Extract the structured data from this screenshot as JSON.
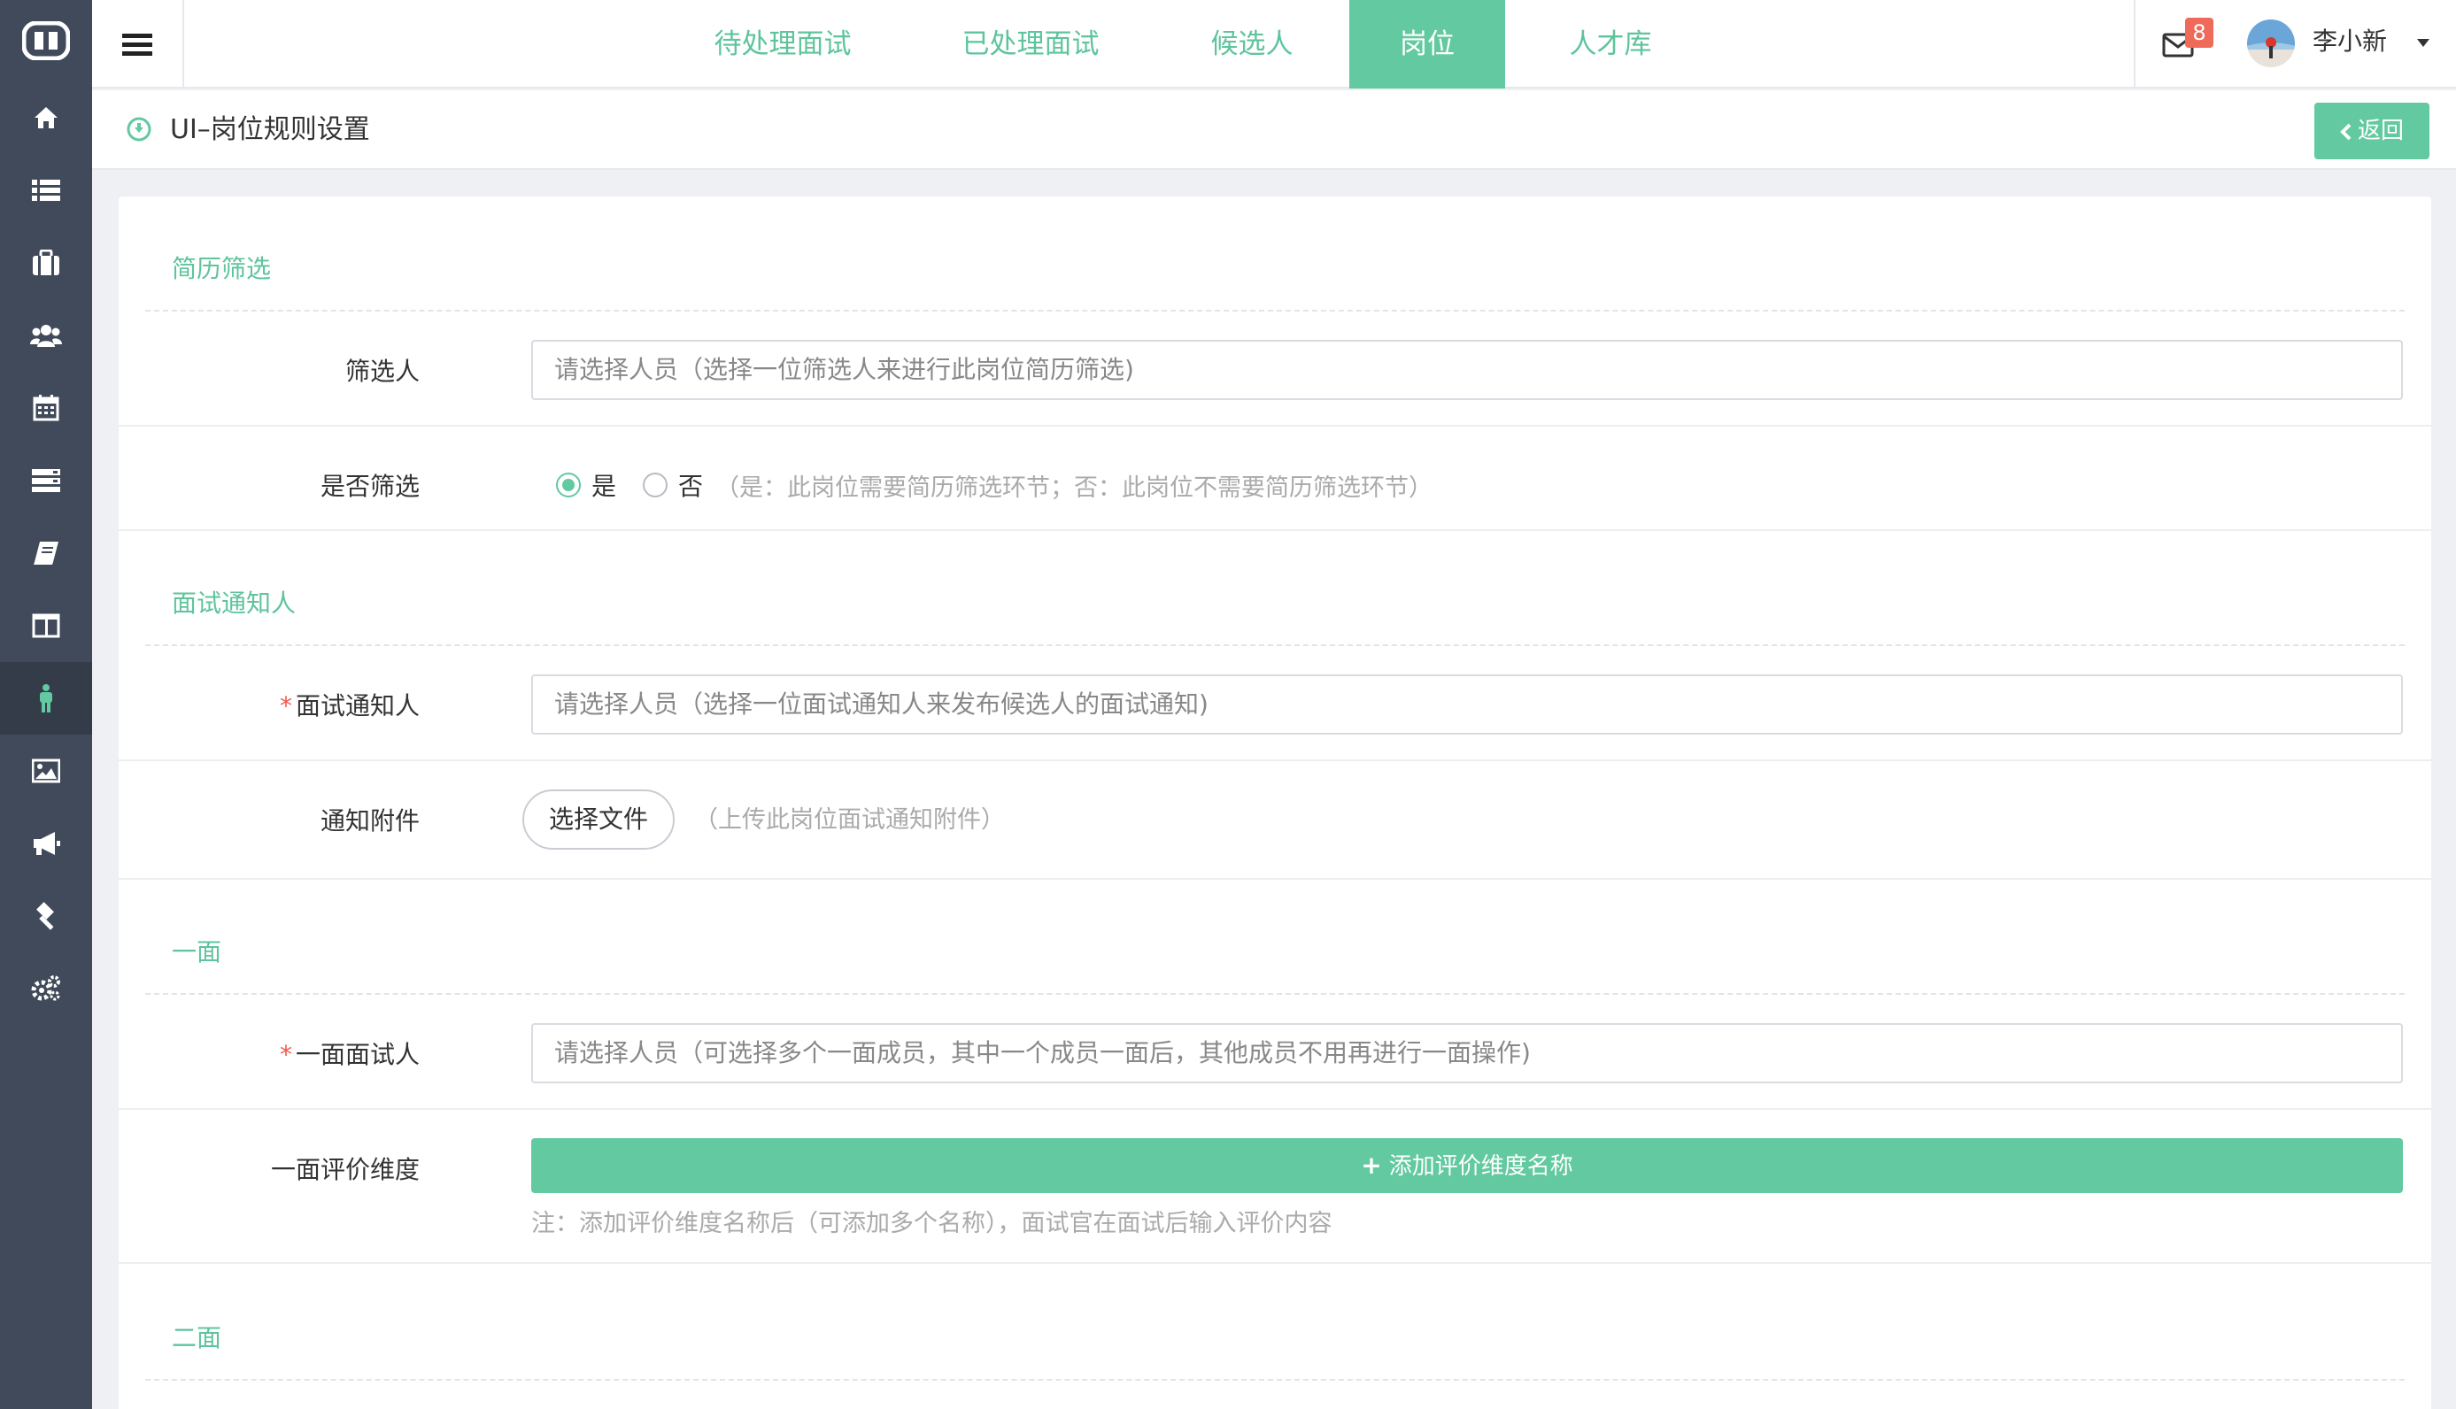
{
  "topbar": {
    "tabs": [
      {
        "label": "待处理面试",
        "active": false
      },
      {
        "label": "已处理面试",
        "active": false
      },
      {
        "label": "候选人",
        "active": false
      },
      {
        "label": "岗位",
        "active": true
      },
      {
        "label": "人才库",
        "active": false
      }
    ],
    "mail_badge": "8",
    "username": "李小新"
  },
  "sidebar": {
    "items": [
      {
        "icon": "home-icon"
      },
      {
        "icon": "list-icon"
      },
      {
        "icon": "briefcase-icon"
      },
      {
        "icon": "users-icon"
      },
      {
        "icon": "calendar-icon"
      },
      {
        "icon": "server-icon"
      },
      {
        "icon": "book-icon"
      },
      {
        "icon": "columns-icon"
      },
      {
        "icon": "person-icon",
        "active": true
      },
      {
        "icon": "image-icon"
      },
      {
        "icon": "bullhorn-icon"
      },
      {
        "icon": "gavel-icon"
      },
      {
        "icon": "cogs-icon"
      }
    ]
  },
  "titlebar": {
    "title": "UI–岗位规则设置",
    "back_label": "返回"
  },
  "form": {
    "resume": {
      "section_title": "简历筛选",
      "screener_label": "筛选人",
      "screener_placeholder": "请选择人员（选择一位筛选人来进行此岗位简历筛选)",
      "screen_label": "是否筛选",
      "yes_label": "是",
      "no_label": "否",
      "screen_hint": "（是：此岗位需要简历筛选环节；否：此岗位不需要简历筛选环节）"
    },
    "notify": {
      "section_title": "面试通知人",
      "notifier_label": "面试通知人",
      "notifier_placeholder": "请选择人员（选择一位面试通知人来发布候选人的面试通知)",
      "attach_label": "通知附件",
      "file_button": "选择文件",
      "attach_hint": "（上传此岗位面试通知附件）"
    },
    "first": {
      "section_title": "一面",
      "interviewer_label": "一面面试人",
      "interviewer_placeholder": "请选择人员（可选择多个一面成员，其中一个成员一面后，其他成员不用再进行一面操作)",
      "dimension_label": "一面评价维度",
      "add_button": "添加评价维度名称",
      "dimension_note": "注：添加评价维度名称后（可添加多个名称），面试官在面试后输入评价内容"
    },
    "second": {
      "section_title": "二面"
    }
  },
  "colors": {
    "accent": "#62c9a0",
    "sidebar": "#404a5a",
    "required": "#f05a4a"
  }
}
